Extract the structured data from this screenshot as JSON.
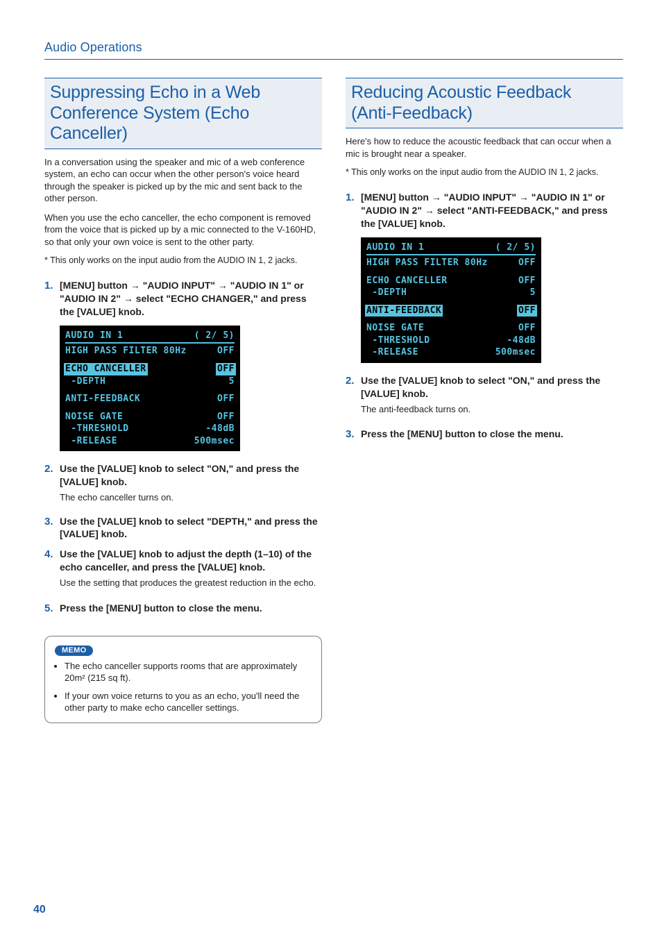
{
  "header": {
    "running": "Audio Operations"
  },
  "page_number": "40",
  "left": {
    "title": "Suppressing Echo in a Web Conference System (Echo Canceller)",
    "intro1": "In a conversation using the speaker and mic of a web conference system, an echo can occur when the other person's voice heard through the speaker is picked up by the mic and sent back to the other person.",
    "intro2": "When you use the echo canceller, the echo component is removed from the voice that is picked up by a mic connected to the V-160HD, so that only your own voice is sent to the other party.",
    "footnote": "* This only works on the input audio from the AUDIO IN 1, 2 jacks.",
    "steps": [
      {
        "num": "1.",
        "parts": [
          {
            "t": "plain",
            "v": "[MENU] button "
          },
          {
            "t": "arrow"
          },
          {
            "t": "plain",
            "v": " \"AUDIO INPUT\" "
          },
          {
            "t": "arrow"
          },
          {
            "t": "plain",
            "v": " \"AUDIO IN 1\" or \"AUDIO IN 2\" "
          },
          {
            "t": "arrow"
          },
          {
            "t": "plain",
            "v": " select \"ECHO CHANGER,\" and press the [VALUE] knob."
          }
        ]
      },
      {
        "num": "2.",
        "instr": "Use the [VALUE] knob to select \"ON,\" and press the [VALUE] knob.",
        "sub": "The echo canceller turns on."
      },
      {
        "num": "3.",
        "instr": "Use the [VALUE] knob to select \"DEPTH,\" and press the [VALUE] knob."
      },
      {
        "num": "4.",
        "instr": "Use the [VALUE] knob to adjust the depth (1–10) of the echo canceller, and press the [VALUE] knob.",
        "sub": "Use the setting that produces the greatest reduction in the echo."
      },
      {
        "num": "5.",
        "instr": "Press the [MENU] button to close the menu."
      }
    ],
    "lcd": {
      "title_left": "AUDIO IN 1",
      "title_right": "( 2/ 5)",
      "rows": [
        {
          "l": "HIGH PASS FILTER 80Hz",
          "r": "OFF"
        },
        {
          "spacer": true
        },
        {
          "l": "ECHO CANCELLER",
          "r": "OFF",
          "hl_l": true,
          "hl_r": true
        },
        {
          "l": " -DEPTH",
          "r": "5"
        },
        {
          "spacer": true
        },
        {
          "l": "ANTI-FEEDBACK",
          "r": "OFF"
        },
        {
          "spacer": true
        },
        {
          "l": "NOISE GATE",
          "r": "OFF"
        },
        {
          "l": " -THRESHOLD",
          "r": "-48dB"
        },
        {
          "l": " -RELEASE",
          "r": "500msec"
        }
      ]
    },
    "memo": {
      "tag": "MEMO",
      "items": [
        "The echo canceller supports rooms that are approximately 20m² (215 sq ft).",
        "If your own voice returns to you as an echo, you'll need the other party to make echo canceller settings."
      ]
    }
  },
  "right": {
    "title": "Reducing Acoustic Feedback (Anti-Feedback)",
    "intro1": "Here's how to reduce the acoustic feedback that can occur when a mic is brought near a speaker.",
    "footnote": "* This only works on the input audio from the AUDIO IN 1, 2 jacks.",
    "steps": [
      {
        "num": "1.",
        "parts": [
          {
            "t": "plain",
            "v": "[MENU] button "
          },
          {
            "t": "arrow"
          },
          {
            "t": "plain",
            "v": " \"AUDIO INPUT\" "
          },
          {
            "t": "arrow"
          },
          {
            "t": "plain",
            "v": " \"AUDIO IN 1\" or \"AUDIO IN 2\" "
          },
          {
            "t": "arrow"
          },
          {
            "t": "plain",
            "v": " select \"ANTI-FEEDBACK,\" and press the [VALUE] knob."
          }
        ]
      },
      {
        "num": "2.",
        "instr": "Use the [VALUE] knob to select \"ON,\" and press the [VALUE] knob.",
        "sub": "The anti-feedback turns on."
      },
      {
        "num": "3.",
        "instr": "Press the [MENU] button to close the menu."
      }
    ],
    "lcd": {
      "title_left": "AUDIO IN 1",
      "title_right": "( 2/ 5)",
      "rows": [
        {
          "l": "HIGH PASS FILTER 80Hz",
          "r": "OFF"
        },
        {
          "spacer": true
        },
        {
          "l": "ECHO CANCELLER",
          "r": "OFF"
        },
        {
          "l": " -DEPTH",
          "r": "5"
        },
        {
          "spacer": true
        },
        {
          "l": "ANTI-FEEDBACK",
          "r": "OFF",
          "hl_l": true,
          "hl_r": true
        },
        {
          "spacer": true
        },
        {
          "l": "NOISE GATE",
          "r": "OFF"
        },
        {
          "l": " -THRESHOLD",
          "r": "-48dB"
        },
        {
          "l": " -RELEASE",
          "r": "500msec"
        }
      ]
    }
  }
}
